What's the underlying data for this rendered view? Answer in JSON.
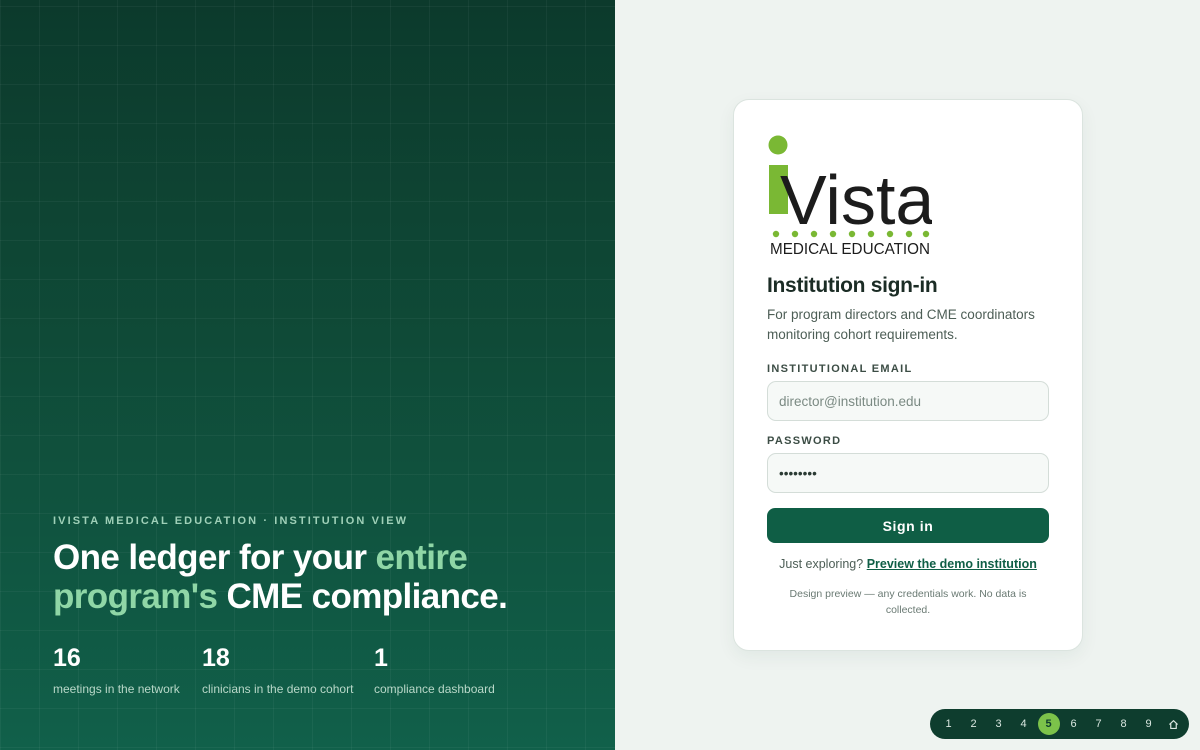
{
  "hero": {
    "eyebrow": "IVISTA MEDICAL EDUCATION · INSTITUTION VIEW",
    "headline_part1": "One ledger for your ",
    "headline_accent": "entire program's",
    "headline_part2": " CME compliance.",
    "stats": [
      {
        "value": "16",
        "label": "meetings in the network"
      },
      {
        "value": "18",
        "label": "clinicians in the demo cohort"
      },
      {
        "value": "1",
        "label": "compliance dashboard"
      }
    ]
  },
  "logo": {
    "wordmark": "Vista",
    "tagline": "MEDICAL EDUCATION",
    "brand_green": "#7ab834",
    "ink": "#1c1c1c"
  },
  "card": {
    "title": "Institution sign-in",
    "subtitle": "For program directors and CME coordinators monitoring cohort requirements.",
    "email_label": "INSTITUTIONAL EMAIL",
    "email_placeholder": "director@institution.edu",
    "password_label": "PASSWORD",
    "password_value": "••••••••",
    "signin_label": "Sign in",
    "explore_prefix": "Just exploring? ",
    "explore_link": "Preview the demo institution",
    "note": "Design preview — any credentials work. No data is collected."
  },
  "pager": {
    "pages": [
      "1",
      "2",
      "3",
      "4",
      "5",
      "6",
      "7",
      "8",
      "9"
    ],
    "home_icon": "home-icon",
    "active_page": "5"
  },
  "colors": {
    "primary": "#0f5e45",
    "accent": "#8fd6a6",
    "pager_active": "#7cc24a"
  }
}
